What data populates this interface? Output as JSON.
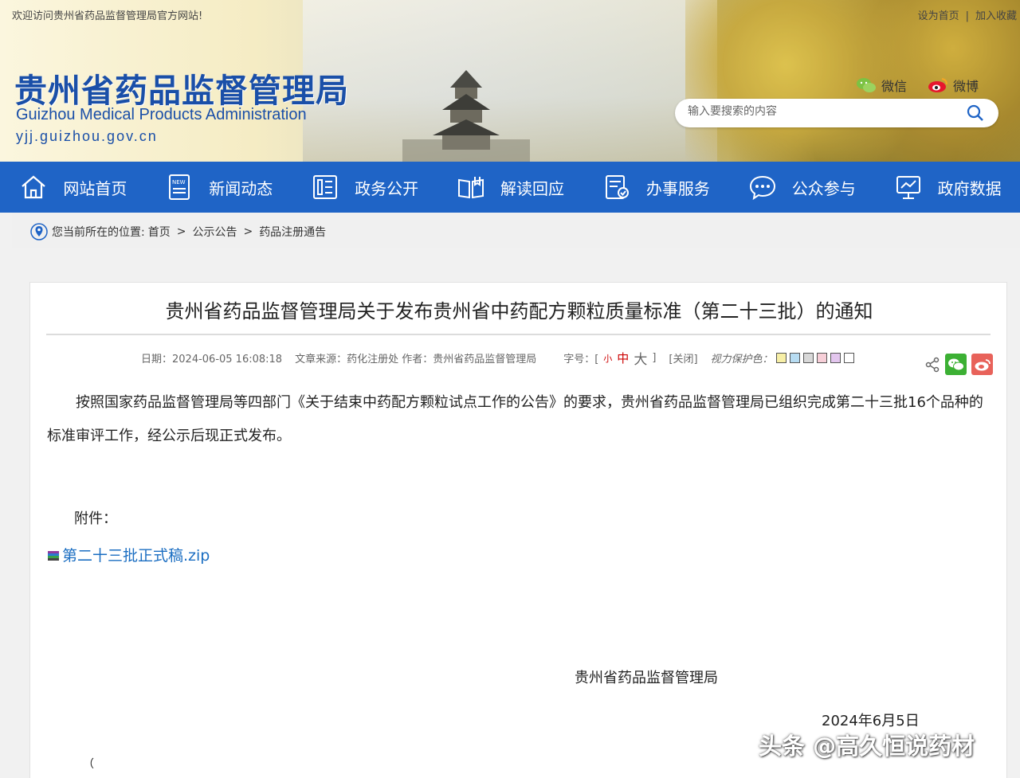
{
  "header": {
    "welcome": "欢迎访问贵州省药品监督管理局官方网站!",
    "set_home": "设为首页",
    "separator": "|",
    "add_favorite": "加入收藏",
    "title_cn": "贵州省药品监督管理局",
    "title_en": "Guizhou Medical Products Administration",
    "url": "yjj.guizhou.gov.cn",
    "social": {
      "wechat": "微信",
      "weibo": "微博"
    },
    "search_placeholder": "输入要搜索的内容"
  },
  "nav": {
    "items": [
      {
        "label": "网站首页",
        "icon": "home-icon"
      },
      {
        "label": "新闻动态",
        "icon": "news-icon"
      },
      {
        "label": "政务公开",
        "icon": "document-icon"
      },
      {
        "label": "解读回应",
        "icon": "book-icon"
      },
      {
        "label": "办事服务",
        "icon": "service-icon"
      },
      {
        "label": "公众参与",
        "icon": "chat-icon"
      },
      {
        "label": "政府数据",
        "icon": "data-icon"
      }
    ],
    "bg_color": "#1f64c6"
  },
  "breadcrumb": {
    "prefix": "您当前所在的位置:",
    "items": [
      "首页",
      "公示公告",
      "药品注册通告"
    ],
    "arrow": ">"
  },
  "article": {
    "title": "贵州省药品监督管理局关于发布贵州省中药配方颗粒质量标准（第二十三批）的通知",
    "meta": {
      "date": "日期：2024-06-05 16:08:18",
      "source": "文章来源：药化注册处 作者：贵州省药品监督管理局",
      "font_label": "字号：[",
      "font_small": "小",
      "font_medium": "中",
      "font_large": "大",
      "font_end": "]",
      "close": "[关闭]",
      "eye_label": "视力保护色：",
      "eye_colors": [
        "#f7efa6",
        "#b7dcf2",
        "#d8d8d8",
        "#f7cfd8",
        "#e3c6ee",
        "#ffffff"
      ]
    },
    "paragraph": "按照国家药品监督管理局等四部门《关于结束中药配方颗粒试点工作的公告》的要求，贵州省药品监督管理局已组织完成第二十三批16个品种的标准审评工作，经公示后现正式发布。",
    "attachment_label": "附件：",
    "attachment_file": "第二十三批正式稿.zip",
    "signer": "贵州省药品监督管理局",
    "date_signed": "2024年6月5日",
    "bottom_fragment": "（"
  },
  "watermark": "头条 @高久恒说药材"
}
